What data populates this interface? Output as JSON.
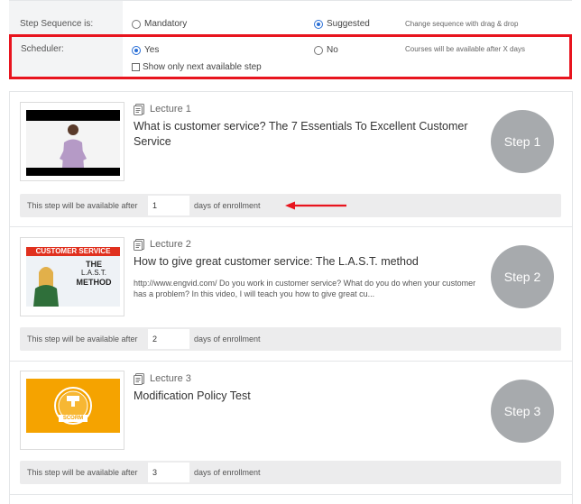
{
  "sequence": {
    "label": "Step Sequence is:",
    "options": [
      {
        "label": "Mandatory",
        "selected": false
      },
      {
        "label": "Suggested",
        "selected": true
      }
    ],
    "hint": "Change sequence with drag & drop"
  },
  "scheduler": {
    "label": "Scheduler:",
    "options": [
      {
        "label": "Yes",
        "selected": true
      },
      {
        "label": "No",
        "selected": false
      }
    ],
    "hint": "Courses will be available after X days",
    "checkbox_label": "Show only next available step",
    "checkbox_checked": false,
    "highlight_color": "#e8141e"
  },
  "steps": [
    {
      "lecture_label": "Lecture 1",
      "title": "What is customer service? The 7 Essentials To Excellent Customer Service",
      "description": "",
      "badge": "Step 1",
      "thumb": "video-presenter-thumbnail",
      "availability": {
        "prefix": "This step will be available after",
        "days": "1",
        "suffix": "days of enrollment"
      }
    },
    {
      "lecture_label": "Lecture 2",
      "title": "How to give great customer service: The L.A.S.T. method",
      "description": "http://www.engvid.com/ Do you work in customer service? What do you do when your customer has a problem? In this video, I will teach you how to give great cu...",
      "badge": "Step 2",
      "thumb": "customer-service-video-thumbnail",
      "thumb_text": {
        "banner": "CUSTOMER SERVICE",
        "line1": "THE",
        "line2": "L.A.S.T.",
        "line3": "METHOD"
      },
      "availability": {
        "prefix": "This step will be available after",
        "days": "2",
        "suffix": "days of enrollment"
      }
    },
    {
      "lecture_label": "Lecture 3",
      "title": "Modification Policy Test",
      "description": "",
      "badge": "Step 3",
      "thumb": "scorm-package-thumbnail",
      "thumb_text": {
        "logo": "SCORM"
      },
      "availability": {
        "prefix": "This step will be available after",
        "days": "3",
        "suffix": "days of enrollment"
      }
    }
  ],
  "colors": {
    "badge": "#a7aaad",
    "accent_blue": "#2a6fd6",
    "arrow": "#e8141e",
    "scorm_bg": "#f5a300"
  }
}
